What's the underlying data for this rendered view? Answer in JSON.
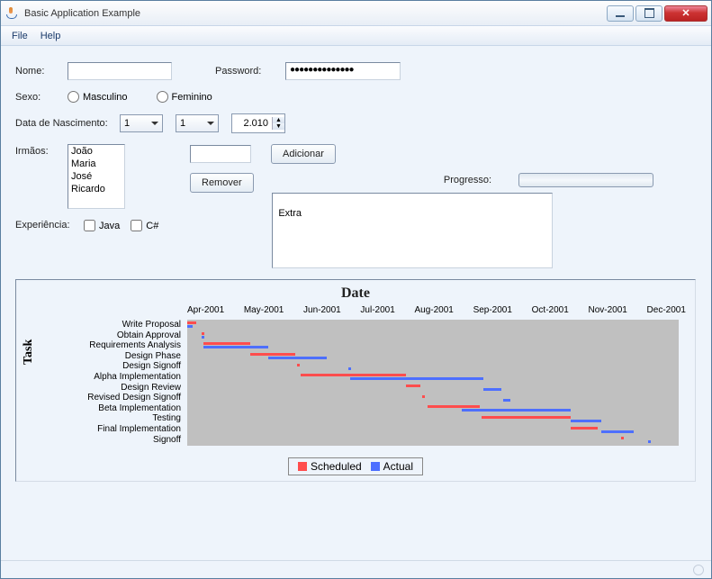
{
  "window": {
    "title": "Basic Application Example"
  },
  "menu": {
    "file": "File",
    "help": "Help"
  },
  "form": {
    "name_label": "Nome:",
    "name_value": "",
    "password_label": "Password:",
    "password_value": "●●●●●●●●●●●●●●",
    "sex_label": "Sexo:",
    "sex_male": "Masculino",
    "sex_female": "Feminino",
    "dob_label": "Data de Nascimento:",
    "dob_day": "1",
    "dob_month": "1",
    "dob_year": "2.010",
    "siblings_label": "Irmãos:",
    "siblings": [
      "João",
      "Maria",
      "José",
      "Ricardo"
    ],
    "sibling_input": "",
    "add_btn": "Adicionar",
    "remove_btn": "Remover",
    "progress_label": "Progresso:",
    "progress_value": 0,
    "exp_label": "Experiência:",
    "exp_java": "Java",
    "exp_csharp": "C#",
    "extra_text": "Extra"
  },
  "chart_data": {
    "type": "gantt",
    "title": "Date",
    "y_axis_label": "Task",
    "x_ticks": [
      "Apr-2001",
      "May-2001",
      "Jun-2001",
      "Jul-2001",
      "Aug-2001",
      "Sep-2001",
      "Oct-2001",
      "Nov-2001",
      "Dec-2001"
    ],
    "x_range_months": [
      "2001-04",
      "2001-12"
    ],
    "tasks": [
      {
        "name": "Write Proposal",
        "scheduled": [
          "2001-04-01",
          "2001-04-06"
        ],
        "actual": [
          "2001-04-01",
          "2001-04-04"
        ]
      },
      {
        "name": "Obtain Approval",
        "scheduled": [
          "2001-04-09",
          "2001-04-10"
        ],
        "actual": [
          "2001-04-09",
          "2001-04-10"
        ]
      },
      {
        "name": "Requirements Analysis",
        "scheduled": [
          "2001-04-10",
          "2001-05-06"
        ],
        "actual": [
          "2001-04-10",
          "2001-05-16"
        ]
      },
      {
        "name": "Design Phase",
        "scheduled": [
          "2001-05-06",
          "2001-05-31"
        ],
        "actual": [
          "2001-05-16",
          "2001-06-18"
        ]
      },
      {
        "name": "Design Signoff",
        "scheduled": [
          "2001-06-01",
          "2001-06-02"
        ],
        "actual": [
          "2001-06-30",
          "2001-07-01"
        ]
      },
      {
        "name": "Alpha Implementation",
        "scheduled": [
          "2001-06-03",
          "2001-08-01"
        ],
        "actual": [
          "2001-07-01",
          "2001-09-13"
        ]
      },
      {
        "name": "Design Review",
        "scheduled": [
          "2001-08-01",
          "2001-08-09"
        ],
        "actual": [
          "2001-09-13",
          "2001-09-23"
        ]
      },
      {
        "name": "Revised Design Signoff",
        "scheduled": [
          "2001-08-10",
          "2001-08-11"
        ],
        "actual": [
          "2001-09-24",
          "2001-09-28"
        ]
      },
      {
        "name": "Beta Implementation",
        "scheduled": [
          "2001-08-13",
          "2001-09-11"
        ],
        "actual": [
          "2001-09-01",
          "2001-11-01"
        ]
      },
      {
        "name": "Testing",
        "scheduled": [
          "2001-09-12",
          "2001-11-01"
        ],
        "actual": [
          "2001-11-01",
          "2001-11-18"
        ]
      },
      {
        "name": "Final Implementation",
        "scheduled": [
          "2001-11-01",
          "2001-11-16"
        ],
        "actual": [
          "2001-11-18",
          "2001-12-06"
        ]
      },
      {
        "name": "Signoff",
        "scheduled": [
          "2001-11-29",
          "2001-11-30"
        ],
        "actual": [
          "2001-12-14",
          "2001-12-15"
        ]
      }
    ],
    "legend": {
      "scheduled": "Scheduled",
      "actual": "Actual"
    },
    "colors": {
      "scheduled": "#ff4d4d",
      "actual": "#4d6fff"
    }
  }
}
